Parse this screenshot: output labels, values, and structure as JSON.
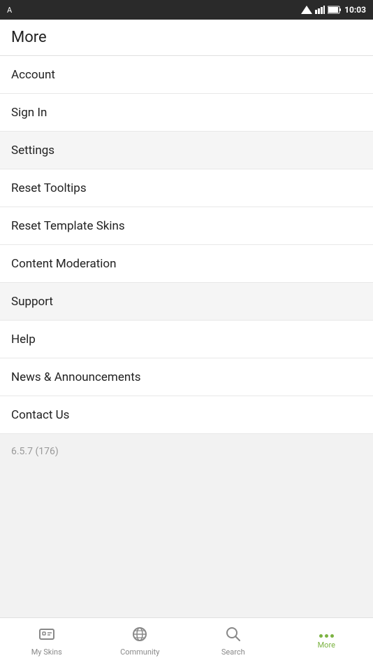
{
  "statusBar": {
    "time": "10:03",
    "appIcon": "A"
  },
  "page": {
    "title": "More"
  },
  "menuItems": [
    {
      "id": "account",
      "label": "Account",
      "section": "main"
    },
    {
      "id": "sign-in",
      "label": "Sign In",
      "section": "main"
    },
    {
      "id": "settings",
      "label": "Settings",
      "section": "gray"
    },
    {
      "id": "reset-tooltips",
      "label": "Reset Tooltips",
      "section": "main"
    },
    {
      "id": "reset-template-skins",
      "label": "Reset Template Skins",
      "section": "main"
    },
    {
      "id": "content-moderation",
      "label": "Content Moderation",
      "section": "main"
    },
    {
      "id": "support",
      "label": "Support",
      "section": "gray"
    },
    {
      "id": "help",
      "label": "Help",
      "section": "main"
    },
    {
      "id": "news-announcements",
      "label": "News & Announcements",
      "section": "main"
    },
    {
      "id": "contact-us",
      "label": "Contact Us",
      "section": "main"
    }
  ],
  "version": "6.5.7 (176)",
  "bottomNav": {
    "items": [
      {
        "id": "my-skins",
        "label": "My Skins",
        "icon": "skins"
      },
      {
        "id": "community",
        "label": "Community",
        "icon": "globe"
      },
      {
        "id": "search",
        "label": "Search",
        "icon": "search"
      },
      {
        "id": "more",
        "label": "More",
        "icon": "dots",
        "active": true
      }
    ]
  }
}
